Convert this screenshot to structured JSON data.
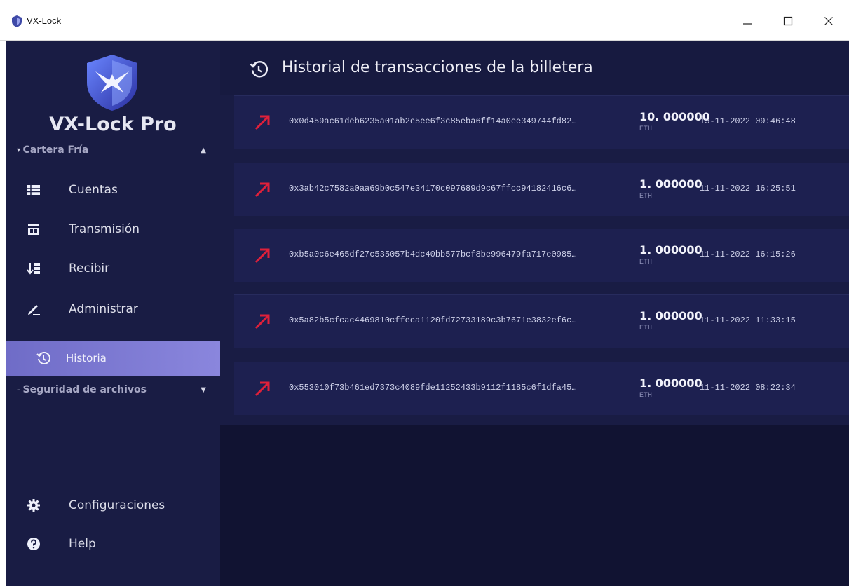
{
  "window": {
    "title": "VX-Lock"
  },
  "sidebar": {
    "brand": "VX-Lock Pro",
    "group_cold_wallet": "Cartera Fría",
    "group_file_security": "Seguridad de archivos",
    "items": [
      {
        "label": "Cuentas",
        "icon": "accounts-icon"
      },
      {
        "label": "Transmisión",
        "icon": "transmit-icon"
      },
      {
        "label": "Recibir",
        "icon": "receive-icon"
      },
      {
        "label": "Administrar",
        "icon": "edit-icon"
      },
      {
        "label": "Historia",
        "icon": "history-icon",
        "active": true
      },
      {
        "label": "Configuraciones",
        "icon": "gear-icon"
      },
      {
        "label": "Help",
        "icon": "help-icon"
      }
    ]
  },
  "main": {
    "title": "Historial de transacciones de la billetera",
    "transactions": [
      {
        "hash": "0x0d459ac61deb6235a01ab2e5ee6f3c85eba6ff14a0ee349744fd82…",
        "amount": "10. 000000",
        "unit": "ETH",
        "datetime": "15-11-2022 09:46:48"
      },
      {
        "hash": "0x3ab42c7582a0aa69b0c547e34170c097689d9c67ffcc94182416c6…",
        "amount": "1. 000000",
        "unit": "ETH",
        "datetime": "11-11-2022 16:25:51"
      },
      {
        "hash": "0xb5a0c6e465df27c535057b4dc40bb577bcf8be996479fa717e0985…",
        "amount": "1. 000000",
        "unit": "ETH",
        "datetime": "11-11-2022 16:15:26"
      },
      {
        "hash": "0x5a82b5cfcac4469810cffeca1120fd72733189c3b7671e3832ef6c…",
        "amount": "1. 000000",
        "unit": "ETH",
        "datetime": "11-11-2022 11:33:15"
      },
      {
        "hash": "0x553010f73b461ed7373c4089fde11252433b9112f1185c6f1dfa45…",
        "amount": "1. 000000",
        "unit": "ETH",
        "datetime": "11-11-2022 08:22:34"
      }
    ]
  },
  "colors": {
    "sidebar_bg": "#191c44",
    "active_item": "#7b78d4",
    "sent_arrow": "#e0203a"
  }
}
